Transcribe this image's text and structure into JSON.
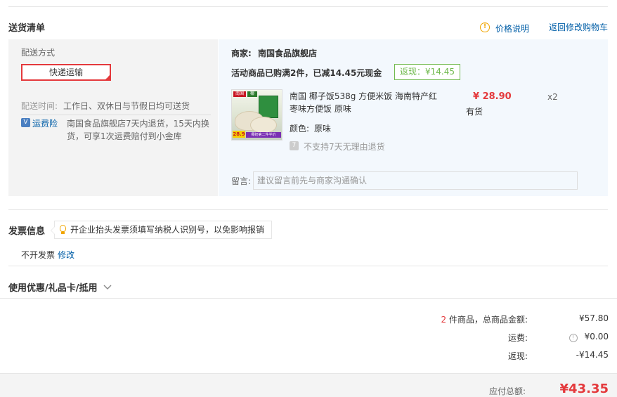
{
  "section": {
    "title": "送货清单",
    "price_note": "价格说明",
    "back_to_cart": "返回修改购物车"
  },
  "delivery": {
    "method_label": "配送方式",
    "method_value": "快递运输",
    "time_label": "配送时间:",
    "time_value": "工作日、双休日与节假日均可送货",
    "insurance_badge": "运费险",
    "insurance_text": "南国食品旗舰店7天内退货，15天内换货，可享1次运费赔付到小金库"
  },
  "order": {
    "merchant_label": "商家:",
    "merchant_name": "南国食品旗舰店",
    "promo_text": "活动商品已购满2件，已减14.45元现金",
    "rebate_tag": "返现：¥14.45",
    "product": {
      "title": "南国 椰子饭538g 方便米饭 海南特产红枣味方便饭 原味",
      "price": "¥ 28.90",
      "stock": "有货",
      "quantity": "x2",
      "color_label": "颜色:",
      "color_value": "原味",
      "no_return": "不支持7天无理由退货",
      "image_logo": "南国",
      "image_logo2": "椰",
      "image_price": "28.9",
      "image_strip": "椰奶第二件半价"
    },
    "message_label": "留言:",
    "message_placeholder": "建议留言前先与商家沟通确认"
  },
  "invoice": {
    "title": "发票信息",
    "tip": "开企业抬头发票须填写纳税人识别号，以免影响报销",
    "value": "不开发票",
    "edit": "修改"
  },
  "coupons": {
    "title": "使用优惠/礼品卡/抵用"
  },
  "summary": {
    "count": "2",
    "count_suffix": "件商品，总商品金额:",
    "goods_amount": "¥57.80",
    "shipping_label": "运费:",
    "shipping_amount": "¥0.00",
    "rebate_label": "返现:",
    "rebate_amount": "-¥14.45",
    "total_label": "应付总额:",
    "total_amount": "¥43.35"
  },
  "colors": {
    "accent_red": "#e4393c",
    "link_blue": "#005ea7",
    "rebate_green": "#6fb94d"
  }
}
